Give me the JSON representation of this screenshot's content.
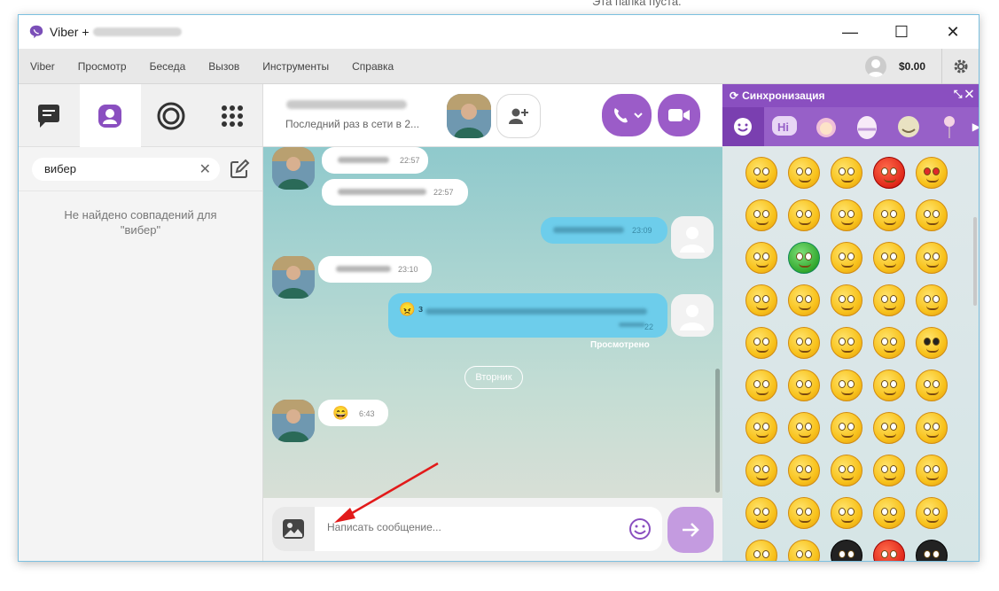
{
  "top_text": "Эта папка пуста.",
  "window": {
    "title": "Viber +",
    "controls": {
      "minimize": "—",
      "maximize": "☐",
      "close": "✕"
    }
  },
  "menu": {
    "items": [
      "Viber",
      "Просмотр",
      "Беседа",
      "Вызов",
      "Инструменты",
      "Справка"
    ],
    "balance": "$0.00"
  },
  "left": {
    "search_value": "вибер",
    "no_results": "Не найдено совпадений для",
    "no_results_query": "\"вибер\""
  },
  "chat": {
    "status": "Последний раз в сети в 2...",
    "messages": [
      {
        "dir": "in",
        "time": "22:57"
      },
      {
        "dir": "in",
        "time": "22:57"
      },
      {
        "dir": "out",
        "time": "23:09"
      },
      {
        "dir": "in",
        "time": "23:10"
      },
      {
        "dir": "out",
        "prefix": "з",
        "time": "22"
      },
      {
        "dir": "in",
        "time": "6:43",
        "emoji": "😄"
      }
    ],
    "seen": "Просмотрено",
    "day": "Вторник",
    "input_placeholder": "Написать сообщение..."
  },
  "panel": {
    "title": "Синхронизация",
    "controls": "⤡  ✕",
    "tabs": [
      "smile",
      "hi",
      "girl",
      "egg",
      "face",
      "rose"
    ]
  },
  "colors": {
    "accent": "#8a4fc0",
    "bubble_out": "#6dcdeb",
    "send": "#c49be0"
  }
}
